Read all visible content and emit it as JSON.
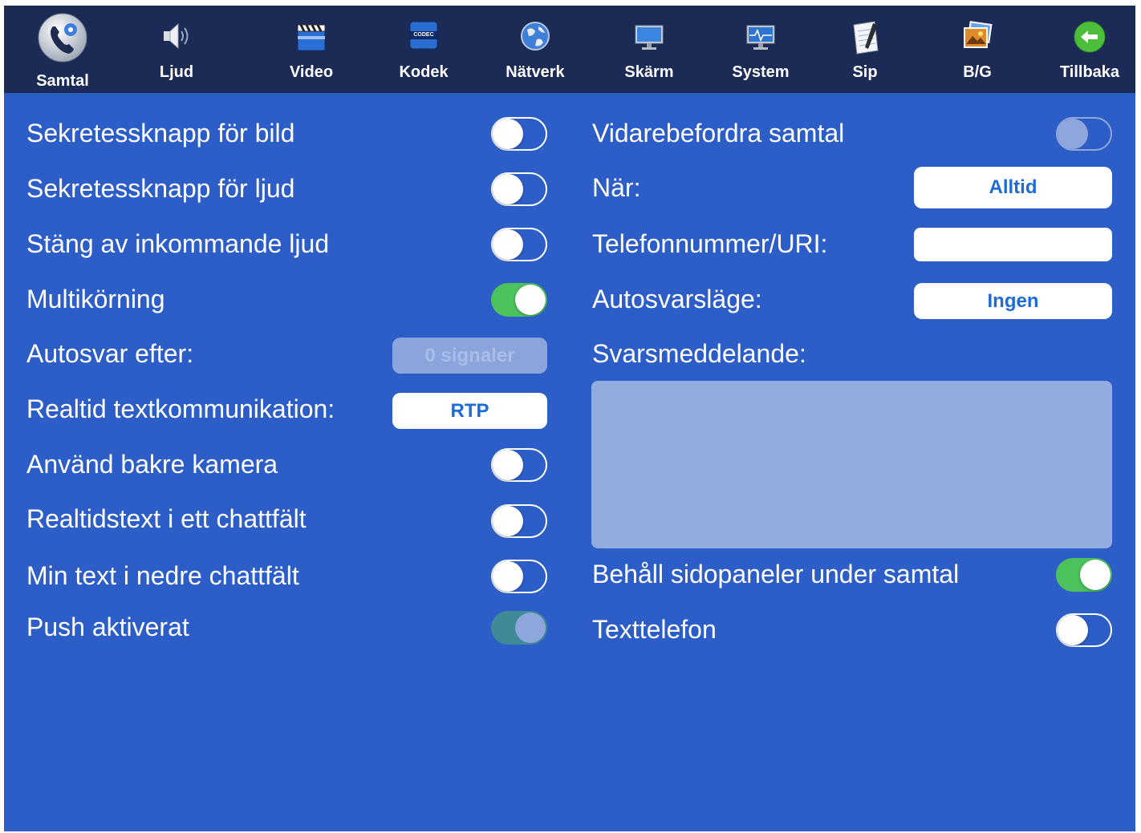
{
  "toolbar": {
    "tabs": [
      {
        "label": "Samtal",
        "icon": "phone-gear-icon"
      },
      {
        "label": "Ljud",
        "icon": "speaker-icon"
      },
      {
        "label": "Video",
        "icon": "clapperboard-icon"
      },
      {
        "label": "Kodek",
        "icon": "codec-icon"
      },
      {
        "label": "Nätverk",
        "icon": "globe-icon"
      },
      {
        "label": "Skärm",
        "icon": "monitor-icon"
      },
      {
        "label": "System",
        "icon": "system-monitor-icon"
      },
      {
        "label": "Sip",
        "icon": "notepad-icon"
      },
      {
        "label": "B/G",
        "icon": "photos-icon"
      },
      {
        "label": "Tillbaka",
        "icon": "back-arrow-icon"
      }
    ],
    "codec_icon_text": "CODEC"
  },
  "left": {
    "video_privacy": {
      "label": "Sekretessknapp för bild",
      "state": "off"
    },
    "audio_privacy": {
      "label": "Sekretessknapp för ljud",
      "state": "off"
    },
    "mute_incoming": {
      "label": "Stäng av inkommande ljud",
      "state": "off"
    },
    "multitasking": {
      "label": "Multikörning",
      "state": "on"
    },
    "autoanswer": {
      "label": "Autosvar efter:",
      "button": "0 signaler"
    },
    "rtt": {
      "label": "Realtid textkommunikation:",
      "button": "RTP"
    },
    "rear_camera": {
      "label": "Använd bakre kamera",
      "state": "off"
    },
    "rtt_chat": {
      "label": "Realtidstext i ett chattfält",
      "state": "off"
    },
    "my_text_lower": {
      "label": "Min text i nedre chattfält",
      "state": "off"
    },
    "push": {
      "label": "Push aktiverat",
      "state": "disabled-on"
    }
  },
  "right": {
    "forward": {
      "label": "Vidarebefordra samtal",
      "state": "disabled-off"
    },
    "when": {
      "label": "När:",
      "button": "Alltid"
    },
    "phone": {
      "label": "Telefonnummer/URI:",
      "value": ""
    },
    "autoanswer_mode": {
      "label": "Autosvarsläge:",
      "button": "Ingen"
    },
    "answer_message": {
      "label": "Svarsmeddelande:",
      "value": ""
    },
    "keep_panels": {
      "label": "Behåll sidopaneler under samtal",
      "state": "on"
    },
    "tty": {
      "label": "Texttelefon",
      "state": "off"
    }
  },
  "colors": {
    "background": "#2d5ec7",
    "toolbar": "#1b2b55",
    "toggle_on": "#4cc25c",
    "button_text": "#1e6bd6"
  }
}
